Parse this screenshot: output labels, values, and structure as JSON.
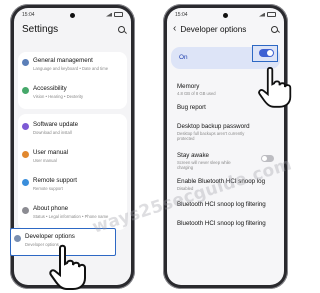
{
  "left_phone": {
    "time": "15:04",
    "title": "Settings",
    "items": [
      {
        "title": "General management",
        "subtitle": "Language and keyboard • Date and time",
        "color": "#5b7fb8"
      },
      {
        "title": "Accessibility",
        "subtitle": "Vision • Hearing • Dexterity",
        "color": "#46a86a"
      },
      {
        "title": "Software update",
        "subtitle": "Download and install",
        "color": "#7d5ad4"
      },
      {
        "title": "User manual",
        "subtitle": "User manual",
        "color": "#e1882f"
      },
      {
        "title": "Remote support",
        "subtitle": "Remote support",
        "color": "#3a8edb"
      },
      {
        "title": "About phone",
        "subtitle": "Status • Legal information • Phone name",
        "color": "#8c8c92"
      }
    ],
    "highlight": {
      "title": "Developer options",
      "subtitle": "Developer options"
    }
  },
  "right_phone": {
    "time": "15:04",
    "title": "Developer options",
    "on_label": "On",
    "items": [
      {
        "title": "Memory",
        "subtitle": "4.8 GB of 8 GB used"
      },
      {
        "title": "Bug report",
        "subtitle": ""
      },
      {
        "title": "Desktop backup password",
        "subtitle": "Desktop full backups aren't currently protected"
      },
      {
        "title": "Stay awake",
        "subtitle": "Screen will never sleep while charging"
      },
      {
        "title": "Enable Bluetooth HCI snoop log",
        "subtitle": "Disabled"
      },
      {
        "title": "Bluetooth HCI snoop log filtering",
        "subtitle": ""
      },
      {
        "title": "Bluetooth HCI snoop log filtering",
        "subtitle": ""
      }
    ]
  },
  "watermark": "ways25secguide.com",
  "colors": {
    "accent": "#3e61d3",
    "highlight_border": "#2d68c4"
  }
}
